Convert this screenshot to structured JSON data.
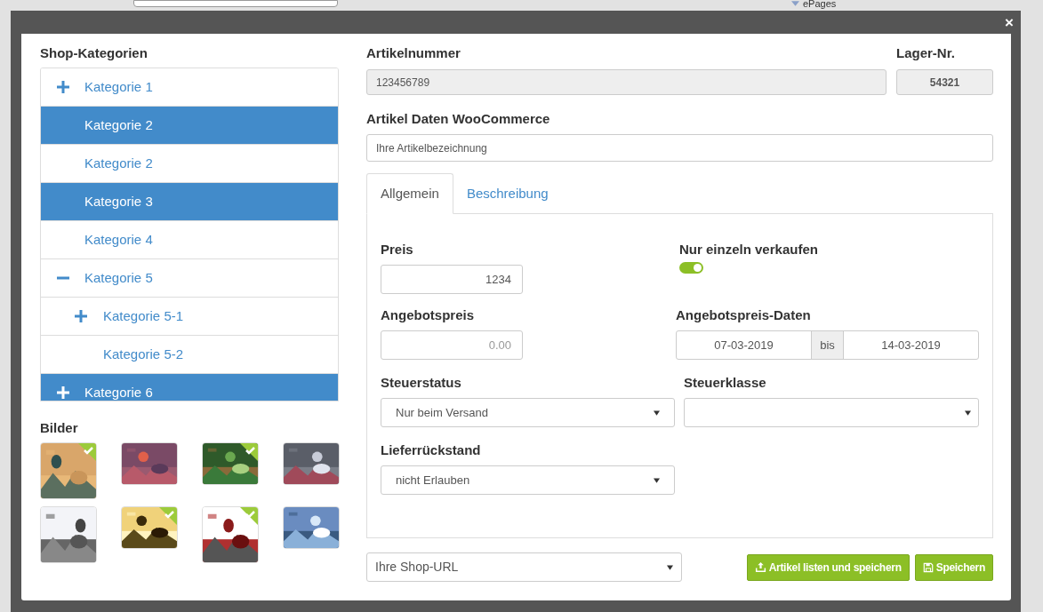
{
  "background": {
    "label": "ePages"
  },
  "dialog": {
    "close": "×"
  },
  "categories": {
    "title": "Shop-Kategorien",
    "items": [
      {
        "label": "Kategorie 1",
        "selected": false,
        "expanded": false
      },
      {
        "label": "Kategorie 2",
        "selected": true
      },
      {
        "label": "Kategorie 2",
        "selected": false
      },
      {
        "label": "Kategorie 3",
        "selected": true
      },
      {
        "label": "Kategorie 4",
        "selected": false
      },
      {
        "label": "Kategorie 5",
        "selected": false,
        "expanded": true,
        "children": [
          {
            "label": "Kategorie 5-1",
            "selected": false,
            "expanded": false
          },
          {
            "label": "Kategorie 5-2",
            "selected": false
          }
        ]
      },
      {
        "label": "Kategorie 6",
        "selected": true,
        "expanded": false
      }
    ]
  },
  "images": {
    "title": "Bilder",
    "items": [
      {
        "kind": "picture",
        "selected": true
      },
      {
        "kind": "picture",
        "selected": false
      },
      {
        "kind": "picture",
        "selected": true
      },
      {
        "kind": "picture",
        "selected": false
      },
      {
        "kind": "picture",
        "selected": false
      },
      {
        "kind": "picture",
        "selected": true
      },
      {
        "kind": "picture",
        "selected": true
      },
      {
        "kind": "picture",
        "selected": false
      }
    ]
  },
  "article_number": {
    "label": "Artikelnummer",
    "value": "123456789"
  },
  "stock_number": {
    "label": "Lager-Nr.",
    "value": "54321"
  },
  "woocommerce": {
    "label": "Artikel Daten WooCommerce",
    "value": "Ihre Artikelbezeichnung"
  },
  "tabs": [
    {
      "label": "Allgemein",
      "selected": true
    },
    {
      "label": "Beschreibung",
      "selected": false
    }
  ],
  "general": {
    "price": {
      "label": "Preis",
      "value": "1234"
    },
    "sell_single": {
      "label": "Nur einzeln verkaufen",
      "on": true
    },
    "offer_price": {
      "label": "Angebotspreis",
      "placeholder": "0.00"
    },
    "offer_dates": {
      "label": "Angebotspreis-Daten",
      "from": "07-03-2019",
      "separator": "bis",
      "to": "14-03-2019"
    },
    "tax_status": {
      "label": "Steuerstatus",
      "value": "Nur beim Versand"
    },
    "tax_class": {
      "label": "Steuerklasse"
    },
    "backorders": {
      "label": "Lieferrückstand",
      "value": "nicht Erlauben"
    }
  },
  "shop_url": {
    "value": "Ihre Shop-URL"
  },
  "buttons": [
    {
      "label": "Artikel listen und speichern",
      "kind": "upload"
    },
    {
      "label": "Speichern",
      "kind": "save"
    }
  ]
}
